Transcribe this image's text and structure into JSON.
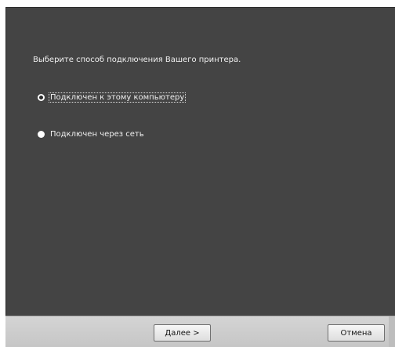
{
  "dialog": {
    "prompt": "Выберите способ подключения Вашего принтера.",
    "options": [
      {
        "label": "Подключен к этому компьютеру",
        "checked": true
      },
      {
        "label": "Подключен через сеть",
        "checked": false
      }
    ],
    "buttons": {
      "next_label": "Далее >",
      "cancel_label": "Отмена"
    }
  },
  "colors": {
    "panel_background": "#444444",
    "text": "#f0f0f0",
    "button_bar": "#cdcdcd"
  }
}
